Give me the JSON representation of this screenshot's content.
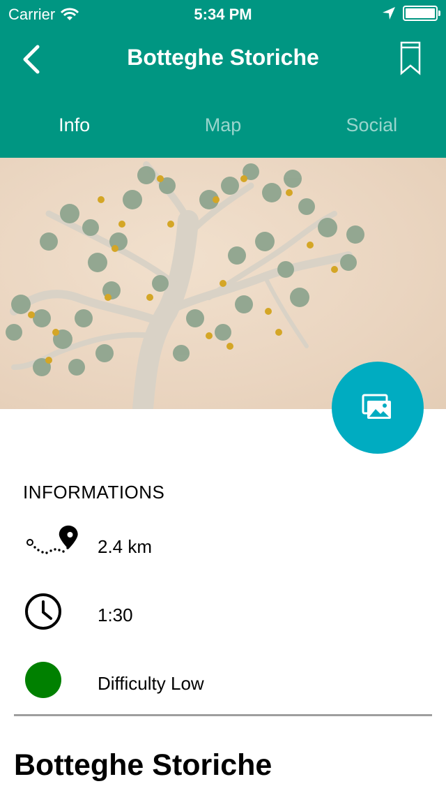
{
  "status_bar": {
    "carrier": "Carrier",
    "time": "5:34 PM"
  },
  "header": {
    "title": "Botteghe Storiche",
    "background_color": "#009682",
    "back_icon": "chevron-left-icon",
    "bookmark_icon": "bookmark-icon"
  },
  "tabs": [
    {
      "label": "Info",
      "active": true
    },
    {
      "label": "Map",
      "active": false
    },
    {
      "label": "Social",
      "active": false
    }
  ],
  "hero": {
    "gallery_button_icon": "gallery-icon",
    "gallery_button_color": "#00acc1"
  },
  "info": {
    "section_title": "INFORMATIONS",
    "distance": "2.4 km",
    "duration": "1:30",
    "difficulty": "Difficulty Low",
    "difficulty_color": "#008000"
  },
  "detail": {
    "title": "Botteghe Storiche"
  }
}
